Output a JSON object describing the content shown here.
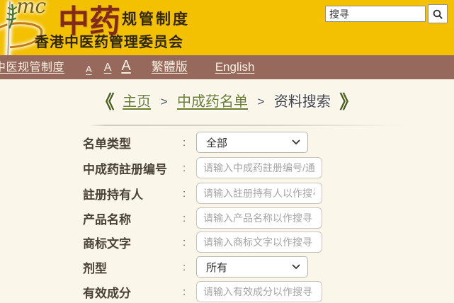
{
  "header": {
    "title_main": "中药",
    "title_suffix": "规管制度",
    "subtitle": "香港中医药管理委员会",
    "search": {
      "placeholder": "搜寻"
    }
  },
  "nav": {
    "items": [
      {
        "label": "中医规管制度"
      },
      {
        "label": "A"
      },
      {
        "label": "A"
      },
      {
        "label": "A"
      },
      {
        "label": "繁體版"
      },
      {
        "label": "English"
      }
    ]
  },
  "breadcrumb": {
    "open_mark": "《",
    "close_mark": "》",
    "separator": ">",
    "items": [
      {
        "label": "主页"
      },
      {
        "label": "中成药名单"
      },
      {
        "label": "资料搜索"
      }
    ]
  },
  "form": {
    "colon": ":",
    "rows": [
      {
        "label": "名单类型",
        "type": "select",
        "value": "全部"
      },
      {
        "label": "中成药註册编号",
        "type": "input",
        "placeholder": "请输入中成药註册编号/通"
      },
      {
        "label": "註册持有人",
        "type": "input",
        "placeholder": "请输入註册持有人以作搜寻"
      },
      {
        "label": "产品名称",
        "type": "input",
        "placeholder": "请输入产品名称以作搜寻"
      },
      {
        "label": "商标文字",
        "type": "input",
        "placeholder": "请输入商标文字以作搜寻"
      },
      {
        "label": "剂型",
        "type": "select",
        "value": "所有"
      },
      {
        "label": "有效成分",
        "type": "input",
        "placeholder": "请输入有效成分以作搜寻"
      }
    ]
  },
  "colors": {
    "header_bg": "#f3c002",
    "nav_bg": "#96695c",
    "page_bg": "#faf6ea",
    "title_red": "#822a1c",
    "link_green": "#6b7c2e",
    "mark_green": "#4d611b"
  }
}
